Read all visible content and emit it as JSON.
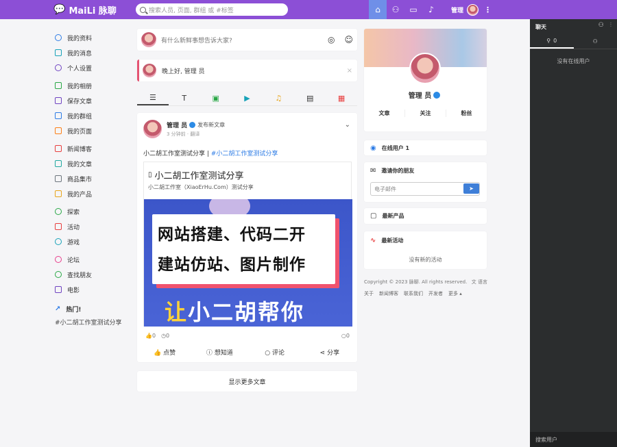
{
  "header": {
    "logo_icon": "wechat-icon",
    "logo_text": "MaiLi 脉聊",
    "search_placeholder": "搜索人员, 页面, 群组 或 #标签",
    "user_name": "管理",
    "nav_icons": [
      "home-icon",
      "user-plus-icon",
      "chat-icon",
      "bell-icon"
    ],
    "accent": "#8c4fd6"
  },
  "sidebar": {
    "items": [
      {
        "label": "我的资料",
        "icon": "user-icon",
        "color": "#2c7be5"
      },
      {
        "label": "我的消息",
        "icon": "message-icon",
        "color": "#17a2b8"
      },
      {
        "label": "个人设置",
        "icon": "gear-icon",
        "color": "#6f42c1"
      },
      {
        "label": "我的相册",
        "icon": "image-icon",
        "color": "#28a745"
      },
      {
        "label": "保存文章",
        "icon": "bookmark-icon",
        "color": "#6f42c1"
      },
      {
        "label": "我的群组",
        "icon": "grid-icon",
        "color": "#2c7be5"
      },
      {
        "label": "我的页面",
        "icon": "flag-icon",
        "color": "#fd7e14"
      },
      {
        "label": "新闻博客",
        "icon": "book-icon",
        "color": "#e83e3e"
      },
      {
        "label": "我的文章",
        "icon": "book-open-icon",
        "color": "#20a8a0"
      },
      {
        "label": "商品集市",
        "icon": "store-icon",
        "color": "#6c757d"
      },
      {
        "label": "我的产品",
        "icon": "bag-icon",
        "color": "#e8a51a"
      },
      {
        "label": "探索",
        "icon": "search-icon",
        "color": "#28a745"
      },
      {
        "label": "活动",
        "icon": "calendar-icon",
        "color": "#e83e3e"
      },
      {
        "label": "游戏",
        "icon": "globe-icon",
        "color": "#17a2b8"
      },
      {
        "label": "论坛",
        "icon": "broadcast-icon",
        "color": "#e83e8c"
      },
      {
        "label": "查找朋友",
        "icon": "map-pin-icon",
        "color": "#28a745"
      },
      {
        "label": "电影",
        "icon": "film-icon",
        "color": "#6f42c1"
      }
    ],
    "hot_title": "热门!",
    "hot_tag": "#小二胡工作室测试分享"
  },
  "composer": {
    "placeholder": "有什么新鲜事想告诉大家?"
  },
  "greeting": {
    "text": "晚上好, 管理 员",
    "close": "×"
  },
  "tabs": [
    "☰",
    "T",
    "▣",
    "▶",
    "♫",
    "▤",
    "▦"
  ],
  "post": {
    "author": "管理 员",
    "action": "发布新文章",
    "time": "3 分钟前 · 翻译",
    "text_prefix": "小二胡工作室测试分享 |",
    "tag": "#小二胡工作室测试分享",
    "link_title": "小二胡工作室测试分享",
    "link_sub": "小二胡工作室（XiaoErHu.Com）测试分享",
    "banner_line1": "网站搭建、代码二开",
    "banner_line2": "建站仿站、图片制作",
    "banner_line3_hl": "让",
    "banner_line3": "小二胡帮你",
    "reactions": "0",
    "wonder": "0",
    "comments": "0",
    "actions": [
      "点赞",
      "想知道",
      "评论",
      "分享"
    ]
  },
  "more_posts": "显示更多文章",
  "profile": {
    "name": "管理 员",
    "stats": [
      "文章",
      "关注",
      "粉丝"
    ]
  },
  "widgets": {
    "online": "在线用户 1",
    "invite_title": "邀请你的朋友",
    "email_placeholder": "电子邮件",
    "latest_products": "最新产品",
    "latest_activities": "最新活动",
    "no_activities": "没有新的活动"
  },
  "footer": {
    "copyright": "Copyright © 2023 脉聊. All rights reserved.",
    "language": "语言",
    "links": [
      "关于",
      "新闻博客",
      "联系我们",
      "开发者",
      "更多 ▴"
    ]
  },
  "chat": {
    "title": "聊天",
    "online_count": "0",
    "empty": "没有在线用户",
    "search": "搜索用户"
  }
}
